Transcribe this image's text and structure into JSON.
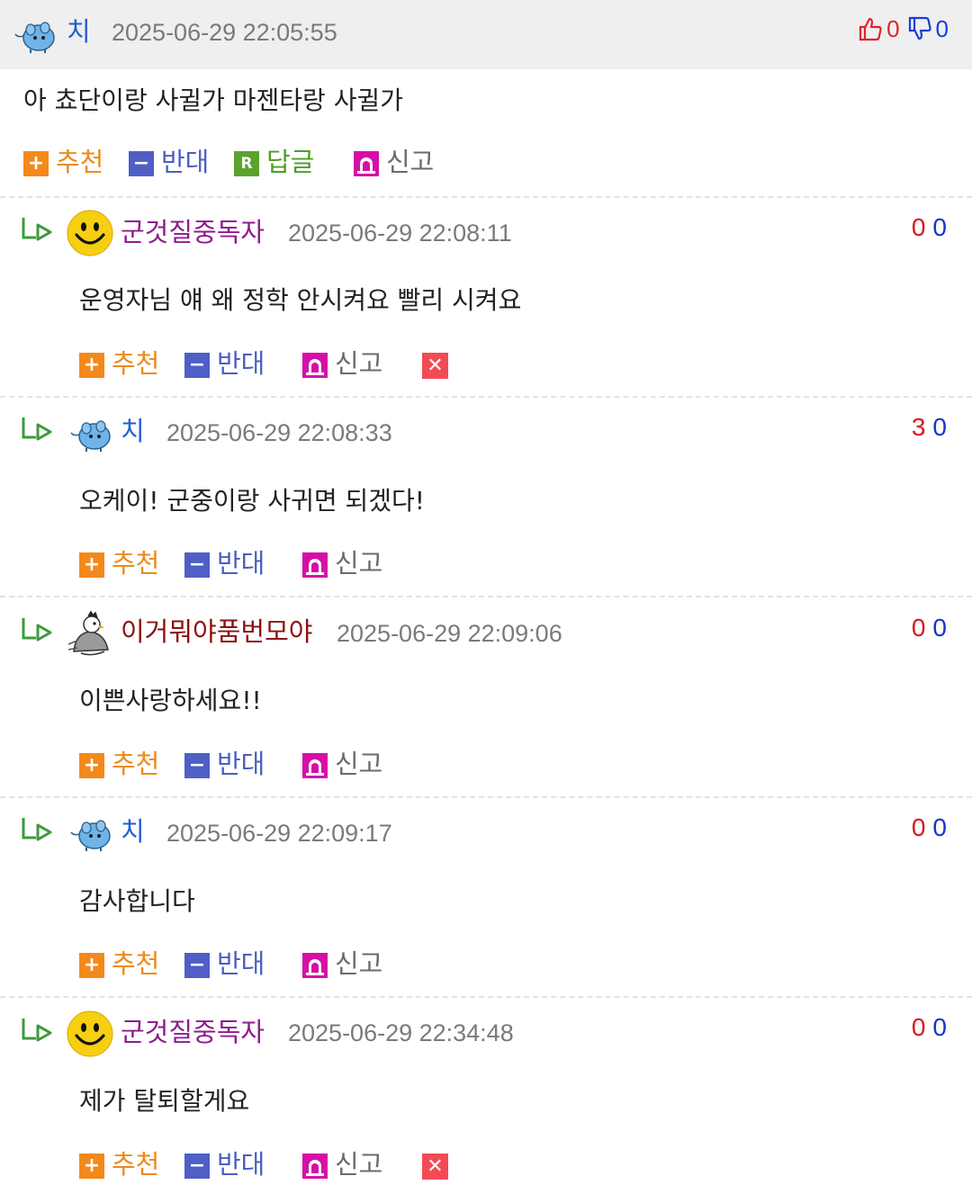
{
  "parent": {
    "author": "치",
    "timestamp": "2025-06-29 22:05:55",
    "up_count": "0",
    "down_count": "0",
    "text": "아 쵸단이랑 사귈가 마젠타랑 사귈가",
    "actions": {
      "recommend": "추천",
      "oppose": "반대",
      "reply": "답글",
      "report": "신고"
    }
  },
  "replies": [
    {
      "author": "군것질중독자",
      "author_color": "#8e1b8e",
      "timestamp": "2025-06-29 22:08:11",
      "up": "0",
      "down": "0",
      "text": "운영자님 얘 왜 정학 안시켜요 빨리 시켜요",
      "actions": {
        "recommend": "추천",
        "oppose": "반대",
        "report": "신고"
      },
      "avatar": "smiley-avatar",
      "deletable": true
    },
    {
      "author": "치",
      "author_color": "#1f5fd0",
      "timestamp": "2025-06-29 22:08:33",
      "up": "3",
      "down": "0",
      "text": "오케이! 군중이랑 사귀면 되겠다!",
      "actions": {
        "recommend": "추천",
        "oppose": "반대",
        "report": "신고"
      },
      "avatar": "blue-creature-avatar",
      "deletable": false
    },
    {
      "author": "이거뭐야품번모야",
      "author_color": "#8a1212",
      "timestamp": "2025-06-29 22:09:06",
      "up": "0",
      "down": "0",
      "text": "이쁜사랑하세요!!",
      "actions": {
        "recommend": "추천",
        "oppose": "반대",
        "report": "신고"
      },
      "avatar": "bird-avatar",
      "deletable": false
    },
    {
      "author": "치",
      "author_color": "#1f5fd0",
      "timestamp": "2025-06-29 22:09:17",
      "up": "0",
      "down": "0",
      "text": "감사합니다",
      "actions": {
        "recommend": "추천",
        "oppose": "반대",
        "report": "신고"
      },
      "avatar": "blue-creature-avatar",
      "deletable": false
    },
    {
      "author": "군것질중독자",
      "author_color": "#8e1b8e",
      "timestamp": "2025-06-29 22:34:48",
      "up": "0",
      "down": "0",
      "text": "제가 탈퇴할게요",
      "actions": {
        "recommend": "추천",
        "oppose": "반대",
        "report": "신고"
      },
      "avatar": "smiley-avatar",
      "deletable": true
    }
  ],
  "colors": {
    "header_bg": "#efefef",
    "recommend": "#ee8a1a",
    "oppose": "#4d5ec2",
    "reply": "#4f9e24",
    "report_icon": "#d60fa8",
    "delete": "#f24b55",
    "up": "#d8151b",
    "down": "#1c34c8"
  }
}
